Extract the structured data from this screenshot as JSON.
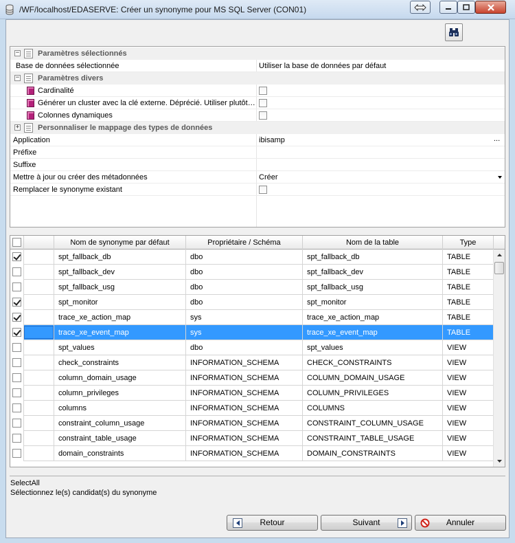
{
  "window": {
    "title": "/WF/localhost/EDASERVE: Créer un synonyme pour MS SQL Server (CON01)"
  },
  "property_grid": {
    "categories": [
      {
        "label": "Paramètres sélectionnés",
        "expander": "−"
      },
      {
        "label": "Paramètres divers",
        "expander": "−"
      },
      {
        "label": "Personnaliser le mappage des types de données",
        "expander": "+"
      }
    ],
    "rows": {
      "base_label": "Base de données sélectionnée",
      "base_value": "Utiliser la base de données par défaut",
      "cardinalite_label": "Cardinalité",
      "cluster_label": "Générer un cluster avec la clé externe. Déprécié. Utiliser plutôt…",
      "colonnes_label": "Colonnes dynamiques",
      "application_label": "Application",
      "application_value": "ibisamp",
      "application_button": "...",
      "prefixe_label": "Préfixe",
      "suffixe_label": "Suffixe",
      "metadonnees_label": "Mettre à jour ou créer des métadonnées",
      "metadonnees_value": "Créer",
      "remplacer_label": "Remplacer le synonyme existant"
    }
  },
  "table": {
    "columns": [
      "Nom de synonyme par défaut",
      "Propriétaire / Schéma",
      "Nom de la table",
      "Type"
    ],
    "rows": [
      {
        "checked": true,
        "name": "spt_fallback_db",
        "owner": "dbo",
        "table": "spt_fallback_db",
        "type": "TABLE"
      },
      {
        "checked": false,
        "name": "spt_fallback_dev",
        "owner": "dbo",
        "table": "spt_fallback_dev",
        "type": "TABLE"
      },
      {
        "checked": false,
        "name": "spt_fallback_usg",
        "owner": "dbo",
        "table": "spt_fallback_usg",
        "type": "TABLE"
      },
      {
        "checked": true,
        "name": "spt_monitor",
        "owner": "dbo",
        "table": "spt_monitor",
        "type": "TABLE"
      },
      {
        "checked": true,
        "name": "trace_xe_action_map",
        "owner": "sys",
        "table": "trace_xe_action_map",
        "type": "TABLE"
      },
      {
        "checked": true,
        "name": "trace_xe_event_map",
        "owner": "sys",
        "table": "trace_xe_event_map",
        "type": "TABLE",
        "selected": true
      },
      {
        "checked": false,
        "name": "spt_values",
        "owner": "dbo",
        "table": "spt_values",
        "type": "VIEW"
      },
      {
        "checked": false,
        "name": "check_constraints",
        "owner": "INFORMATION_SCHEMA",
        "table": "CHECK_CONSTRAINTS",
        "type": "VIEW"
      },
      {
        "checked": false,
        "name": "column_domain_usage",
        "owner": "INFORMATION_SCHEMA",
        "table": "COLUMN_DOMAIN_USAGE",
        "type": "VIEW"
      },
      {
        "checked": false,
        "name": "column_privileges",
        "owner": "INFORMATION_SCHEMA",
        "table": "COLUMN_PRIVILEGES",
        "type": "VIEW"
      },
      {
        "checked": false,
        "name": "columns",
        "owner": "INFORMATION_SCHEMA",
        "table": "COLUMNS",
        "type": "VIEW"
      },
      {
        "checked": false,
        "name": "constraint_column_usage",
        "owner": "INFORMATION_SCHEMA",
        "table": "CONSTRAINT_COLUMN_USAGE",
        "type": "VIEW"
      },
      {
        "checked": false,
        "name": "constraint_table_usage",
        "owner": "INFORMATION_SCHEMA",
        "table": "CONSTRAINT_TABLE_USAGE",
        "type": "VIEW"
      },
      {
        "checked": false,
        "name": "domain_constraints",
        "owner": "INFORMATION_SCHEMA",
        "table": "DOMAIN_CONSTRAINTS",
        "type": "VIEW"
      }
    ]
  },
  "status": {
    "line1": "SelectAll",
    "line2": "Sélectionnez le(s) candidat(s) du synonyme"
  },
  "buttons": {
    "back": "Retour",
    "next": "Suivant",
    "cancel": "Annuler"
  },
  "colors": {
    "selection": "#3399ff",
    "window_frame": "#c8dcee"
  }
}
